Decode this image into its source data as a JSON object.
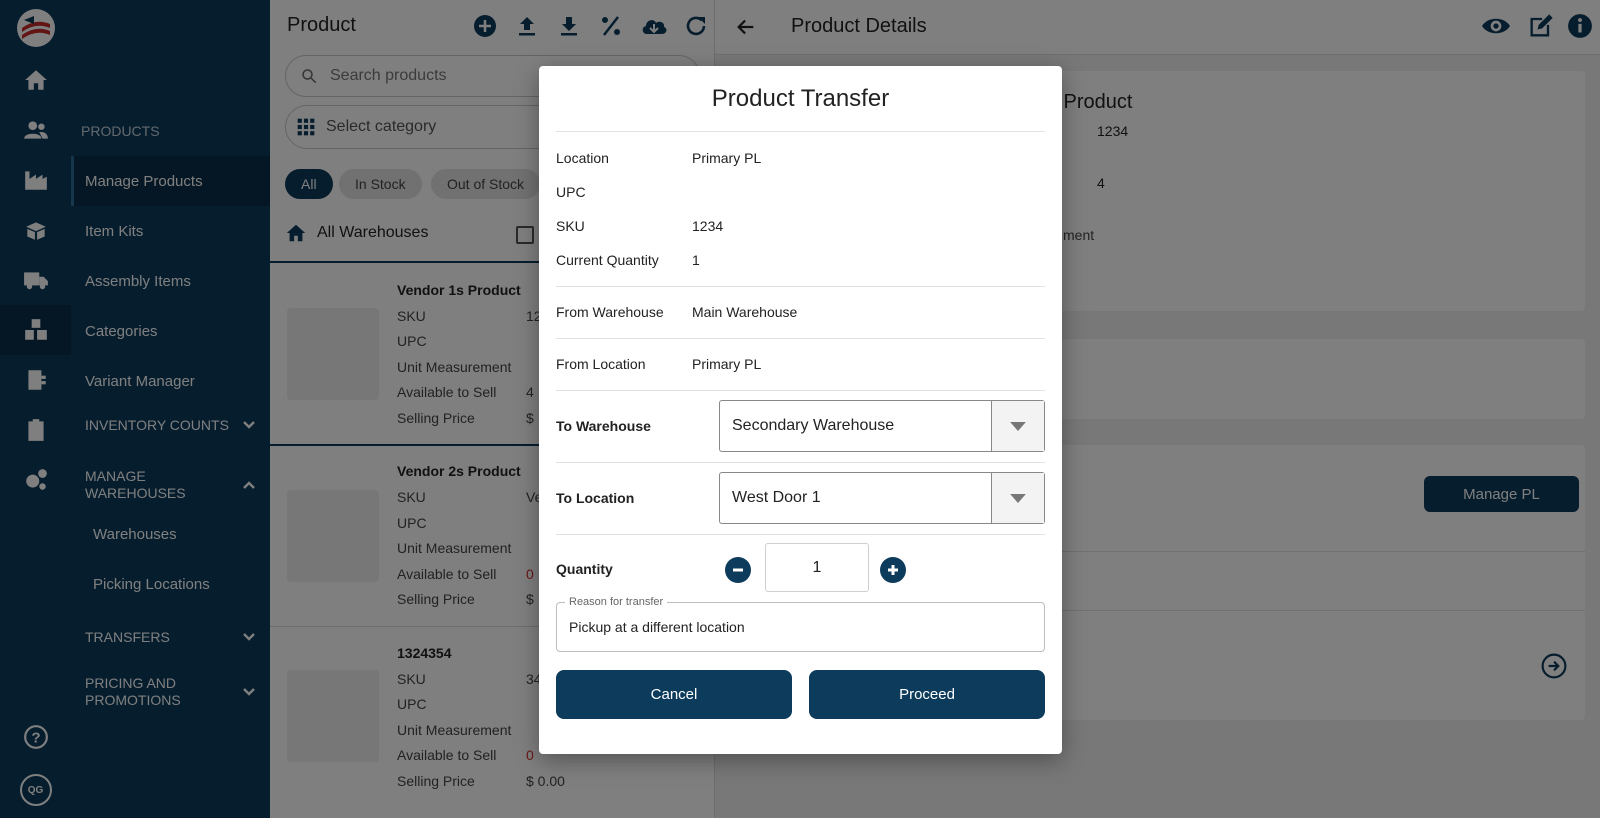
{
  "colors": {
    "primary": "#0d3b5c",
    "sidebar": "#0d3b5c",
    "danger": "#d32f2f"
  },
  "rail": {
    "icons": [
      "logo-icon",
      "home-icon",
      "users-icon",
      "factory-icon",
      "box-open-icon",
      "truck-icon",
      "boxes-icon",
      "clipboard-list-icon",
      "clipboard-icon",
      "gears-icon",
      "help-icon",
      "avatar"
    ],
    "avatar_initials": "QG"
  },
  "sidenav": {
    "section_title": "PRODUCTS",
    "items": [
      "Manage Products",
      "Item Kits",
      "Assembly Items",
      "Categories",
      "Variant Manager"
    ],
    "inventory_counts": "INVENTORY COUNTS",
    "manage_warehouses": "MANAGE WAREHOUSES",
    "warehouse_sub": [
      "Warehouses",
      "Picking Locations"
    ],
    "transfers": "TRANSFERS",
    "pricing": "PRICING AND PROMOTIONS"
  },
  "list": {
    "title": "Product",
    "search_placeholder": "Search products",
    "category_placeholder": "Select category",
    "chips": [
      "All",
      "In Stock",
      "Out of Stock"
    ],
    "warehouse_tab": "All Warehouses",
    "field_labels": [
      "SKU",
      "UPC",
      "Unit Measurement",
      "Available to Sell",
      "Selling Price"
    ],
    "products": [
      {
        "name": "Vendor 1s Product",
        "sku": "12",
        "available": "4",
        "price": "$"
      },
      {
        "name": "Vendor 2s Product",
        "sku": "Ve",
        "available": "0",
        "price": "$"
      },
      {
        "name": "1324354",
        "sku": "34",
        "available": "0",
        "price": "$ 0.00"
      }
    ]
  },
  "detail": {
    "title": "Product Details",
    "product_name_fragment": "s Product",
    "val_1": "1234",
    "val_2": "4",
    "frag_ment": "ment",
    "manage_pl": "Manage PL"
  },
  "modal": {
    "title": "Product Transfer",
    "location_label": "Location",
    "location_value": "Primary PL",
    "upc_label": "UPC",
    "upc_value": "",
    "sku_label": "SKU",
    "sku_value": "1234",
    "qty_label": "Current Quantity",
    "qty_value": "1",
    "from_wh_label": "From Warehouse",
    "from_wh_value": "Main Warehouse",
    "from_loc_label": "From Location",
    "from_loc_value": "Primary PL",
    "to_wh_label": "To Warehouse",
    "to_wh_value": "Secondary Warehouse",
    "to_loc_label": "To Location",
    "to_loc_value": "West Door 1",
    "quantity_label": "Quantity",
    "quantity_value": "1",
    "reason_label": "Reason for transfer",
    "reason_value": "Pickup at a different location",
    "cancel": "Cancel",
    "proceed": "Proceed"
  }
}
